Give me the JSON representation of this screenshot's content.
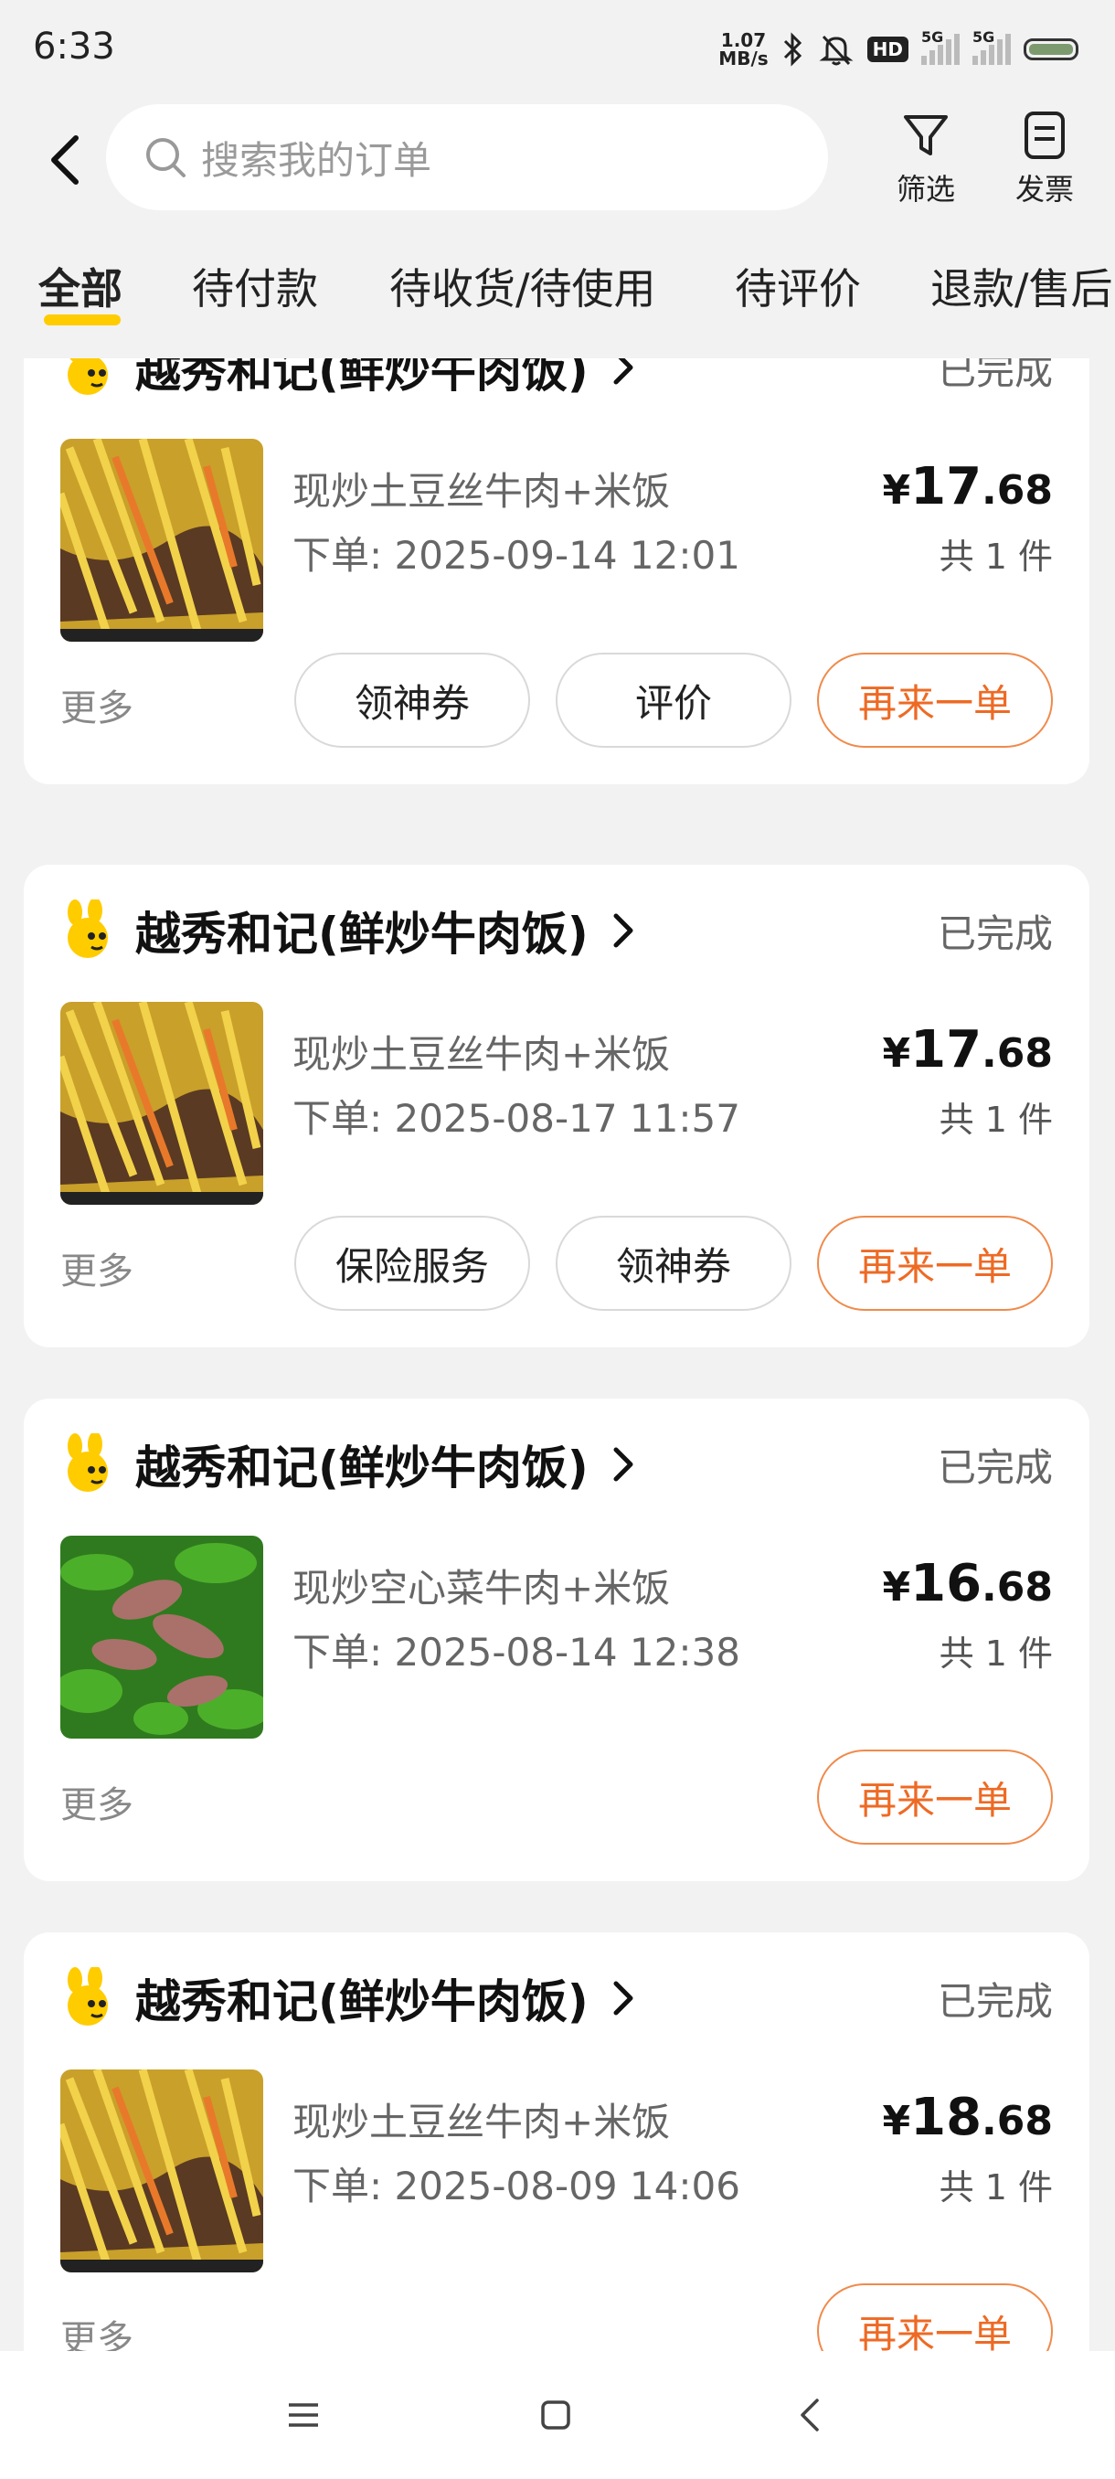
{
  "status_bar": {
    "time": "6:33",
    "net_speed_value": "1.07",
    "net_speed_unit": "MB/s",
    "hd_label": "HD",
    "sim1_label": "5G",
    "sim2_label": "5G"
  },
  "header": {
    "search_placeholder": "搜索我的订单",
    "filter_label": "筛选",
    "invoice_label": "发票"
  },
  "tabs": [
    {
      "label": "全部",
      "active": true
    },
    {
      "label": "待付款"
    },
    {
      "label": "待收货/待使用"
    },
    {
      "label": "待评价"
    },
    {
      "label": "退款/售后"
    }
  ],
  "orders": [
    {
      "shop": "越秀和记(鲜炒牛肉饭)",
      "status": "已完成",
      "item": "现炒土豆丝牛肉+米饭",
      "time": "下单: 2025-09-14 12:01",
      "price_currency": "¥",
      "price_int": "17",
      "price_dec": ".68",
      "qty": "共 1 件",
      "image": "potato-beef-photo",
      "more": "更多",
      "buttons": [
        "领神券",
        "评价",
        "再来一单"
      ]
    },
    {
      "shop": "越秀和记(鲜炒牛肉饭)",
      "status": "已完成",
      "item": "现炒土豆丝牛肉+米饭",
      "time": "下单: 2025-08-17 11:57",
      "price_currency": "¥",
      "price_int": "17",
      "price_dec": ".68",
      "qty": "共 1 件",
      "image": "potato-beef-photo",
      "more": "更多",
      "buttons": [
        "保险服务",
        "领神券",
        "再来一单"
      ]
    },
    {
      "shop": "越秀和记(鲜炒牛肉饭)",
      "status": "已完成",
      "item": "现炒空心菜牛肉+米饭",
      "time": "下单: 2025-08-14 12:38",
      "price_currency": "¥",
      "price_int": "16",
      "price_dec": ".68",
      "qty": "共 1 件",
      "image": "water-spinach-beef-photo",
      "more": "更多",
      "buttons": [
        "再来一单"
      ]
    },
    {
      "shop": "越秀和记(鲜炒牛肉饭)",
      "status": "已完成",
      "item": "现炒土豆丝牛肉+米饭",
      "time": "下单: 2025-08-09 14:06",
      "price_currency": "¥",
      "price_int": "18",
      "price_dec": ".68",
      "qty": "共 1 件",
      "image": "potato-beef-photo",
      "more": "更多",
      "buttons": [
        "再来一单"
      ]
    }
  ],
  "colors": {
    "accent_orange": "#ee6a24",
    "tab_indicator": "#ffcc00",
    "background": "#f2f2f2"
  },
  "nav_bar": {
    "icons": [
      "menu-icon",
      "home-icon",
      "back-icon"
    ]
  }
}
